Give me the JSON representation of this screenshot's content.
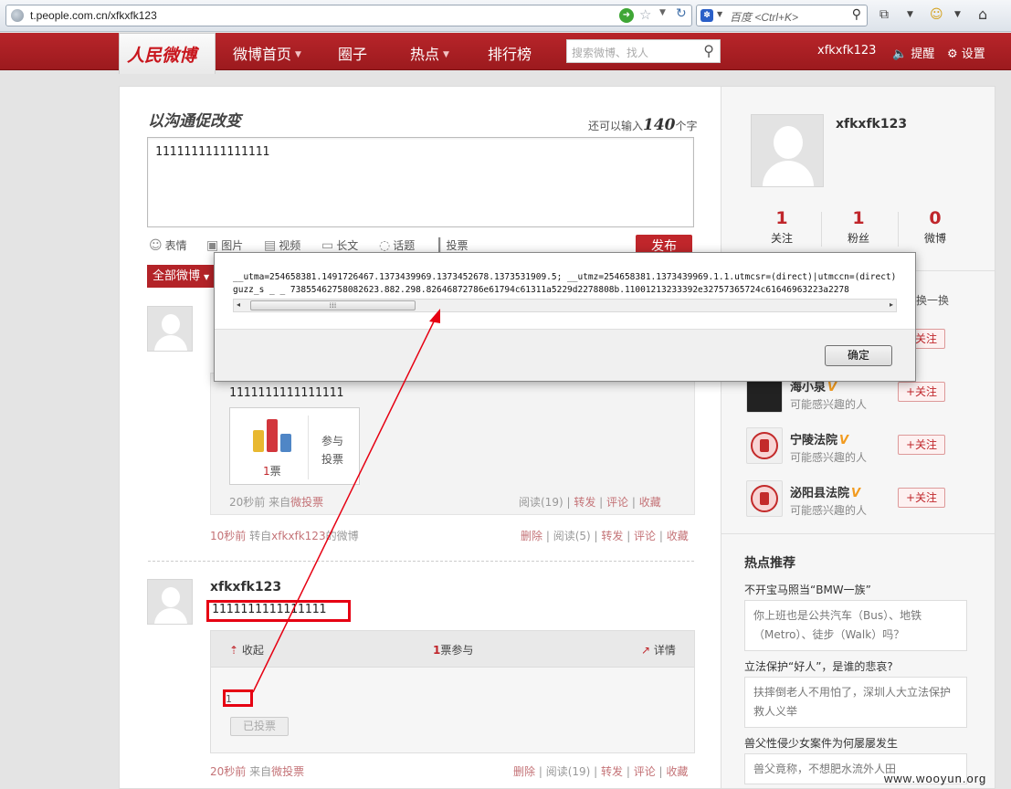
{
  "browser": {
    "url": "t.people.com.cn/xfkxfk123",
    "search_placeholder": "百度 <Ctrl+K>"
  },
  "site": {
    "logo": "人民微博",
    "nav": [
      {
        "label": "微博首页",
        "has_caret": true
      },
      {
        "label": "圈子",
        "has_caret": false
      },
      {
        "label": "热点",
        "has_caret": true
      },
      {
        "label": "排行榜",
        "has_caret": false
      }
    ],
    "search_placeholder": "搜索微博、找人",
    "user": "xfkxfk123",
    "remind": "提醒",
    "settings": "设置"
  },
  "composer": {
    "slogan": "以沟通促改变",
    "remain_prefix": "还可以输入",
    "remain_count": "140",
    "remain_suffix": "个字",
    "value": "1111111111111111",
    "tools": [
      "表情",
      "图片",
      "视频",
      "长文",
      "话题",
      "投票"
    ],
    "publish": "发布",
    "filter": "全部微博"
  },
  "post1": {
    "forward_text": "1111111111111111",
    "vote_count": "1",
    "vote_unit": "票",
    "join_vote": "参与投票",
    "inner_meta_time": "20秒前",
    "inner_meta_from": "来自",
    "inner_meta_src": "微投票",
    "inner_actions": [
      "阅读(19)",
      "转发",
      "评论",
      "收藏"
    ],
    "meta_time": "10秒前",
    "meta_from": "转自",
    "meta_user": "xfkxfk123",
    "meta_suffix": "的微博",
    "actions": [
      "删除",
      "阅读(5)",
      "转发",
      "评论",
      "收藏"
    ]
  },
  "post2": {
    "username": "xfkxfk123",
    "text": "1111111111111111",
    "collapse": "收起",
    "participants_count": "1",
    "participants_label": "票参与",
    "detail": "详情",
    "option": "1",
    "voted": "已投票",
    "meta_time": "20秒前",
    "meta_from": "来自",
    "meta_src": "微投票",
    "actions": [
      "删除",
      "阅读(19)",
      "转发",
      "评论",
      "收藏"
    ]
  },
  "sidebar": {
    "username": "xfkxfk123",
    "stats": [
      {
        "num": "1",
        "label": "关注"
      },
      {
        "num": "1",
        "label": "粉丝"
      },
      {
        "num": "0",
        "label": "微博"
      }
    ],
    "change": "换一换",
    "recommend": [
      {
        "name": "海小泉",
        "sub": "可能感兴趣的人",
        "follow": "+关注"
      },
      {
        "name": "宁陵法院",
        "sub": "可能感兴趣的人",
        "follow": "+关注"
      },
      {
        "name": "泌阳县法院",
        "sub": "可能感兴趣的人",
        "follow": "+关注"
      }
    ],
    "follow_top": "+关注",
    "hot_title": "热点推荐",
    "hot": [
      {
        "q": "不开宝马照当“BMW一族”",
        "a": "你上班也是公共汽车（Bus）、地铁（Metro）、徒步（Walk）吗？"
      },
      {
        "q": "立法保护“好人”，是谁的悲哀?",
        "a": "扶摔倒老人不用怕了，深圳人大立法保护救人义举"
      },
      {
        "q": "兽父性侵少女案件为何屡屡发生",
        "a": "兽父竟称，不想肥水流外人田"
      }
    ]
  },
  "dialog": {
    "line1": "__utma=254658381.1491726467.1373439969.1373452678.1373531909.5; __utmz=254658381.1373439969.1.1.utmcsr=(direct)|utmccn=(direct)",
    "line2": "guzz_s    _    _     73855462758082623.882.298.82646872786e61794c61311a5229d2278808b.11001213233392e32757365724c61646963223a2278",
    "ok": "确定"
  },
  "watermark": "www.wooyun.org",
  "colors": {
    "brand": "#b8252a",
    "highlight": "#e60012"
  }
}
